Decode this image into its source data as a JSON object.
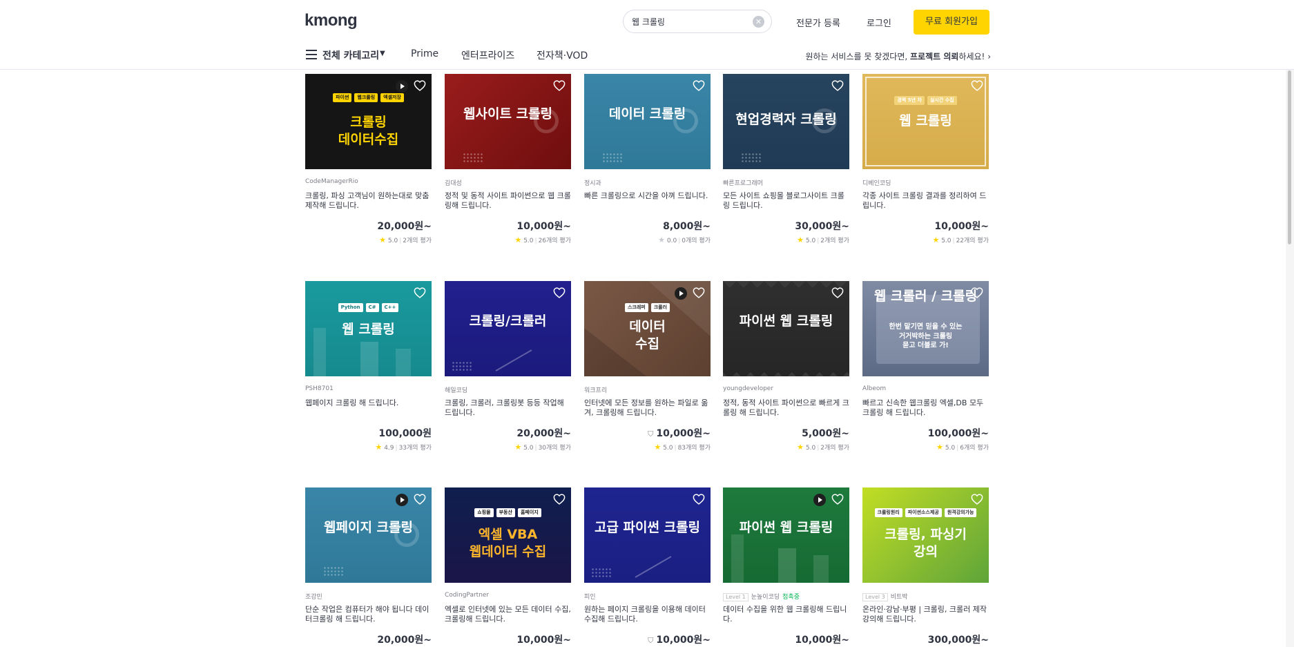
{
  "header": {
    "logo": "kmong",
    "search_value": "웹 크롤링",
    "expert_register": "전문가 등록",
    "login": "로그인",
    "signup": "무료 회원가입",
    "category_label": "전체 카테고리",
    "tabs": [
      "Prime",
      "엔터프라이즈",
      "전자책·VOD"
    ],
    "project_cta_pre": "원하는 서비스를 못 찾겠다면, ",
    "project_cta_bold": "프로젝트 의뢰",
    "project_cta_post": "하세요!"
  },
  "colors": {
    "brand_yellow": "#ffd400",
    "text": "#303441",
    "sub_text": "#7b7d86"
  },
  "cards": [
    {
      "thumb_title": "크롤링\n데이터수집",
      "tags": [
        "파이썬",
        "웹크롤링",
        "엑셀저장"
      ],
      "seller": "CodeManagerRio",
      "desc": "크롤링, 파싱 고객님이 원하는대로 맞춤 제작해 드립니다.",
      "price": "20,000원~",
      "rating": "5.0",
      "reviews": "2개의 평가",
      "video": true
    },
    {
      "thumb_title": "웹사이트 크롤링",
      "tags": [],
      "seller": "김대성",
      "desc": "정적 및 동적 사이트 파이썬으로 웹 크롤링해 드립니다.",
      "price": "10,000원~",
      "rating": "5.0",
      "reviews": "26개의 평가",
      "video": false
    },
    {
      "thumb_title": "데이터 크롤링",
      "tags": [],
      "seller": "정시과",
      "desc": "빠른 크롤링으로 시간을 아껴 드립니다.",
      "price": "8,000원~",
      "rating": "0.0",
      "reviews": "0개의 평가",
      "video": false
    },
    {
      "thumb_title": "현업경력자 크롤링",
      "tags": [],
      "seller": "빠른프로그래머",
      "desc": "모든 사이트 쇼핑몰 블로그사이트 크롤링 드립니다.",
      "price": "30,000원~",
      "rating": "5.0",
      "reviews": "2개의 평가",
      "video": false
    },
    {
      "thumb_title": "웹 크롤링",
      "tags": [
        "경력 5년 차",
        "실시간 수집"
      ],
      "seller": "디베인코딩",
      "desc": "각종 사이트 크롤링 결과를 정리하여 드립니다.",
      "price": "10,000원~",
      "rating": "5.0",
      "reviews": "22개의 평가",
      "video": false
    },
    {
      "thumb_title": "웹 크롤링",
      "tags": [
        "Python",
        "C#",
        "C++"
      ],
      "seller": "PSH8701",
      "desc": "웹페이지 크롤링 해 드립니다.",
      "price": "100,000원",
      "rating": "4.9",
      "reviews": "33개의 평가",
      "video": false
    },
    {
      "thumb_title": "크롤링/크롤러",
      "tags": [],
      "seller": "해일코딩",
      "desc": "크롤링, 크롤러, 크롤링봇 등등 작업해 드립니다.",
      "price": "20,000원~",
      "rating": "5.0",
      "reviews": "30개의 평가",
      "video": false
    },
    {
      "thumb_title": "데이터\n수집",
      "tags": [
        "스크래퍼",
        "크롤러"
      ],
      "seller": "워크프리",
      "desc": "인터넷에 모든 정보를 원하는 파일로 옮겨, 크롤링해 드립니다.",
      "price": "10,000원~",
      "rating": "5.0",
      "reviews": "83개의 평가",
      "video": true,
      "price_icon": "prime-icon"
    },
    {
      "thumb_title": "파이썬 웹 크롤링",
      "tags": [],
      "seller": "youngdeveloper",
      "desc": "정적, 동적 사이트 파이썬으로 빠르게 크롤링 해 드립니다.",
      "price": "5,000원~",
      "rating": "5.0",
      "reviews": "2개의 평가",
      "video": false
    },
    {
      "thumb_title": "웹 크롤러 / 크롤링",
      "thumb_sub": "한번 맡기면 믿을 수 있는\n거거박하는 크롤링\n묻고 더블로 가!",
      "tags": [],
      "seller": "Albeom",
      "desc": "빠르고 신속한 웹크롤링 엑셀,DB 모두 크롤링 해 드립니다.",
      "price": "100,000원~",
      "rating": "5.0",
      "reviews": "6개의 평가",
      "video": false
    },
    {
      "thumb_title": "웹페이지 크롤링",
      "tags": [],
      "seller": "조강민",
      "desc": "단순 작업은 컴퓨터가 해야 됩니다 데이터크롤링 해 드립니다.",
      "price": "20,000원~",
      "video": true
    },
    {
      "thumb_title": "엑셀 VBA\n웹데이터 수집",
      "tags": [
        "쇼핑몰",
        "부동산",
        "홈페이지"
      ],
      "seller": "CodingPartner",
      "desc": "엑셀로 인터넷에 있는 모든 데이터 수집, 크롤링해 드립니다.",
      "price": "10,000원~",
      "video": false
    },
    {
      "thumb_title": "고급 파이썬 크롤링",
      "tags": [],
      "seller": "피인",
      "desc": "원하는 페이지 크롤링을 이용해 데이터 수집해 드립니다.",
      "price": "10,000원~",
      "video": false,
      "price_icon": "prime-icon"
    },
    {
      "thumb_title": "파이썬 웹 크롤링",
      "tags": [],
      "seller": "눈높이코딩",
      "seller_level": "Level 1",
      "seller_badge": "첨촉중",
      "desc": "데이터 수집을 위한 웹 크롤링해 드립니다.",
      "price": "10,000원~",
      "video": true
    },
    {
      "thumb_title": "크롤링, 파싱기\n강의",
      "tags": [
        "크롤링원리",
        "파이썬소스제공",
        "원격강의가능"
      ],
      "seller": "비트박",
      "seller_level": "Level 3",
      "desc": "온라인·강남·부평 | 크롤링, 크롤러 제작 강의해 드립니다.",
      "price": "300,000원~",
      "video": false
    }
  ]
}
